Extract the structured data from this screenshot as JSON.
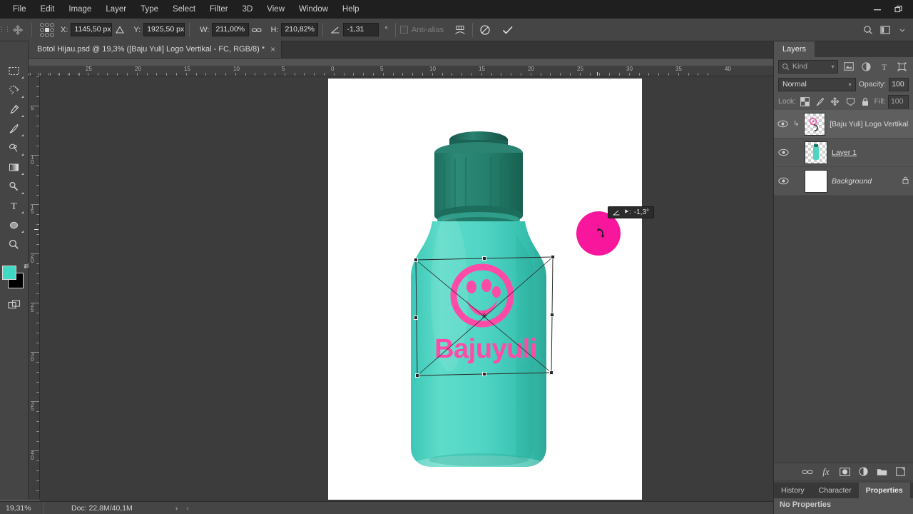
{
  "menu": {
    "items": [
      "File",
      "Edit",
      "Image",
      "Layer",
      "Type",
      "Select",
      "Filter",
      "3D",
      "View",
      "Window",
      "Help"
    ],
    "minimize_icon": "minimize-icon",
    "restore_icon": "restore-icon"
  },
  "options_bar": {
    "tool_icon": "move-tool-icon",
    "reference_point_label": "reference-point-grid",
    "x_label": "X:",
    "x_value": "1145,50 px",
    "delta_icon": "relative-position-icon",
    "y_label": "Y:",
    "y_value": "1925,50 px",
    "w_label": "W:",
    "w_value": "211,00%",
    "link_icon": "link-icon",
    "h_label": "H:",
    "h_value": "210,82%",
    "angle_icon": "angle-icon",
    "angle_value": "-1,31",
    "degree_symbol": "°",
    "antialias_label": "Anti-alias",
    "warp_icon": "warp-icon",
    "cancel_icon": "cancel-transform-icon",
    "commit_icon": "commit-transform-icon",
    "search_icon": "search-icon",
    "workspace_icon": "workspace-icon"
  },
  "document_tab": {
    "title": "Botol Hijau.psd @ 19,3% ([Baju Yuli] Logo Vertikal - FC, RGB/8) *",
    "close_label": "×"
  },
  "toolbar": {
    "tools": [
      {
        "name": "rectangular-marquee-tool",
        "glyph": "marquee"
      },
      {
        "name": "lasso-tool",
        "glyph": "lasso"
      },
      {
        "name": "eyedropper-tool",
        "glyph": "eyedropper"
      },
      {
        "name": "brush-tool",
        "glyph": "brush"
      },
      {
        "name": "clone-stamp-tool",
        "glyph": "clone"
      },
      {
        "name": "gradient-tool",
        "glyph": "gradient"
      },
      {
        "name": "dodge-tool",
        "glyph": "dodge"
      },
      {
        "name": "type-tool",
        "glyph": "type"
      },
      {
        "name": "ellipse-tool",
        "glyph": "ellipse"
      },
      {
        "name": "zoom-tool",
        "glyph": "zoom"
      }
    ],
    "foreground_color": "#3fd9c4",
    "background_color": "#000000",
    "swap_icon": "swap-colors-icon",
    "quickmask_icon": "quick-mask-icon",
    "screenmode_icon": "screen-mode-icon"
  },
  "rulers": {
    "horizontal_labels": [
      "25",
      "20",
      "15",
      "10",
      "5",
      "0",
      "5",
      "10",
      "15",
      "20",
      "25",
      "30",
      "35",
      "40"
    ],
    "vertical_labels": [
      "5",
      "10",
      "15",
      "20",
      "25",
      "30",
      "35",
      "40"
    ],
    "unit": "cm"
  },
  "canvas": {
    "artboard_background": "#ffffff",
    "bottle_body_color": "#4fd4c4",
    "bottle_cap_color": "#1f7a69",
    "logo_color": "#ff4aa8",
    "logo_text": "Bajuyuli",
    "logo_mark": "smiley-paw-logo-icon"
  },
  "transform": {
    "handles": 8,
    "center_marker": "transform-center-icon"
  },
  "cursor_tooltip": {
    "icon": "angle-icon",
    "label": "⯈:",
    "value": "-1,3°",
    "pink_circle_color": "#f7169c",
    "rotate_cursor_icon": "rotate-cursor-icon"
  },
  "status_bar": {
    "zoom": "19,31%",
    "doc_info": "Doc: 22,8M/40,1M",
    "arrow_right": "›",
    "arrow_left": "‹"
  },
  "layers_panel": {
    "tab_label": "Layers",
    "filter": {
      "search_icon": "search-icon",
      "kind_label": "Kind",
      "caret": "▾",
      "icons": [
        "pixel-filter-icon",
        "adjustment-filter-icon",
        "type-filter-icon",
        "shape-filter-icon"
      ]
    },
    "blend_mode": "Normal",
    "blend_caret": "▾",
    "opacity_label": "Opacity:",
    "opacity_value": "100",
    "lock_label": "Lock:",
    "lock_icons": [
      "lock-transparency-icon",
      "lock-image-icon",
      "lock-position-icon",
      "lock-artboard-icon",
      "lock-all-icon"
    ],
    "fill_label": "Fill:",
    "fill_value": "100",
    "layers": [
      {
        "name": "[Baju Yuli] Logo Vertikal ..",
        "visible": true,
        "selected": true,
        "clipped": true,
        "locked": false,
        "thumb": "transparent-logo-thumb",
        "style": "normal"
      },
      {
        "name": "Layer 1",
        "visible": true,
        "selected": false,
        "clipped": false,
        "locked": false,
        "thumb": "bottle-thumb",
        "style": "underline"
      },
      {
        "name": "Background",
        "visible": true,
        "selected": false,
        "clipped": false,
        "locked": true,
        "thumb": "white-thumb",
        "style": "italic",
        "lock_glyph": "🔒"
      }
    ],
    "footer_icons": [
      "link-layers-icon",
      "layer-style-icon",
      "layer-mask-icon",
      "adjustment-layer-icon",
      "new-group-icon",
      "new-layer-icon"
    ],
    "footer_fx_label": "fx"
  },
  "bottom_panel": {
    "tabs": [
      {
        "label": "History",
        "active": false
      },
      {
        "label": "Character",
        "active": false
      },
      {
        "label": "Properties",
        "active": true
      }
    ],
    "body_text": "No Properties"
  }
}
